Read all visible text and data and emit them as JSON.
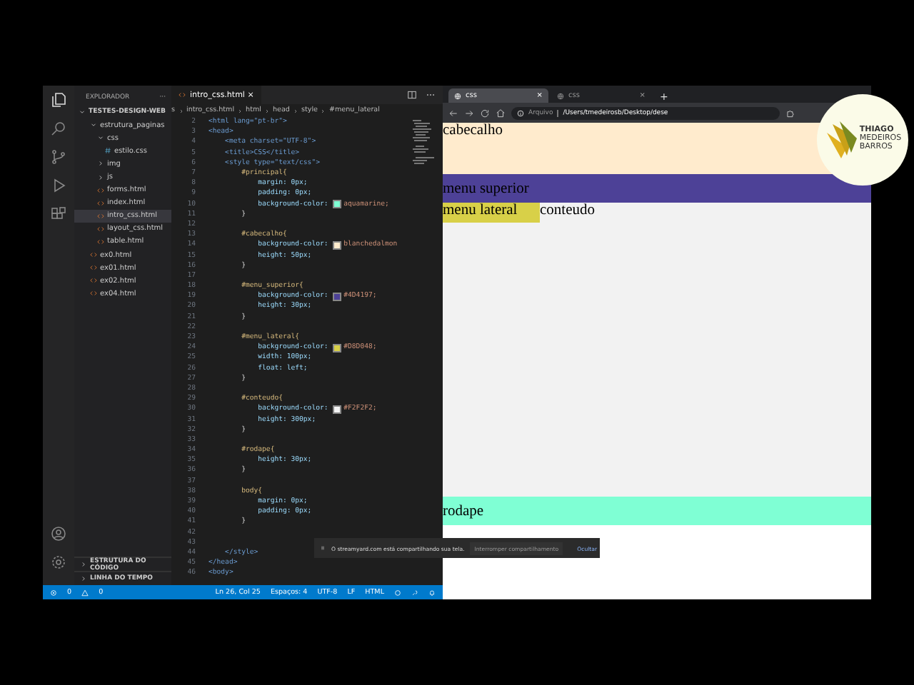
{
  "editor_window": {
    "explorer": {
      "title": "EXPLORADOR",
      "more": "···",
      "root": {
        "label": "TESTES-DESIGN-WEB",
        "expanded": true,
        "children": [
          {
            "label": "estrutura_paginas",
            "kind": "folder",
            "expanded": true,
            "selected": false,
            "children": [
              {
                "label": "css",
                "kind": "folder",
                "expanded": true,
                "selected": false,
                "children": [
                  {
                    "label": "estilo.css",
                    "kind": "css",
                    "selected": false
                  }
                ]
              },
              {
                "label": "img",
                "kind": "folder",
                "expanded": false,
                "selected": false
              },
              {
                "label": "js",
                "kind": "folder",
                "expanded": false,
                "selected": false
              },
              {
                "label": "forms.html",
                "kind": "html",
                "selected": false
              },
              {
                "label": "index.html",
                "kind": "html",
                "selected": false
              },
              {
                "label": "intro_css.html",
                "kind": "html",
                "selected": true
              },
              {
                "label": "layout_css.html",
                "kind": "html",
                "selected": false
              },
              {
                "label": "table.html",
                "kind": "html",
                "selected": false
              }
            ]
          },
          {
            "label": "ex0.html",
            "kind": "html",
            "selected": false
          },
          {
            "label": "ex01.html",
            "kind": "html",
            "selected": false
          },
          {
            "label": "ex02.html",
            "kind": "html",
            "selected": false
          },
          {
            "label": "ex04.html",
            "kind": "html",
            "selected": false
          }
        ]
      },
      "sections": [
        {
          "label": "ESTRUTURA DO CÓDIGO",
          "expanded": false
        },
        {
          "label": "LINHA DO TEMPO",
          "expanded": false
        }
      ]
    },
    "tab": {
      "label": "intro_css.html",
      "close": "×"
    },
    "breadcrumbs": [
      "s",
      "intro_css.html",
      "html",
      "head",
      "style",
      "#menu_lateral"
    ],
    "code": {
      "lines": [
        {
          "n": "2",
          "kind": "tag",
          "text": "<html lang=\"pt-br\">"
        },
        {
          "n": "3",
          "kind": "tag",
          "text": "<head>"
        },
        {
          "n": "4",
          "kind": "tag",
          "text": "    <meta charset=\"UTF-8\">"
        },
        {
          "n": "5",
          "kind": "tag",
          "text": "    <title>CSS</title>"
        },
        {
          "n": "6",
          "kind": "tag",
          "text": "    <style type=\"text/css\">"
        },
        {
          "n": "7",
          "kind": "selector",
          "text": "        #principal{"
        },
        {
          "n": "8",
          "kind": "prop",
          "text": "            margin: 0px;"
        },
        {
          "n": "9",
          "kind": "prop",
          "text": "            padding: 0px;"
        },
        {
          "n": "10",
          "kind": "prop",
          "text": "            background-color: ",
          "color": "#7fffd4",
          "value": "aquamarine;"
        },
        {
          "n": "11",
          "kind": "brace",
          "text": "        }"
        },
        {
          "n": "12"
        },
        {
          "n": "13",
          "kind": "selector",
          "text": "        #cabecalho{"
        },
        {
          "n": "14",
          "kind": "prop",
          "text": "            background-color: ",
          "color": "#ffebcd",
          "value": "blanchedalmon"
        },
        {
          "n": "15",
          "kind": "prop",
          "text": "            height: 50px;"
        },
        {
          "n": "16",
          "kind": "brace",
          "text": "        }"
        },
        {
          "n": "17"
        },
        {
          "n": "18",
          "kind": "selector",
          "text": "        #menu_superior{"
        },
        {
          "n": "19",
          "kind": "prop",
          "text": "            background-color: ",
          "color": "#4d4197",
          "value": "#4D4197;"
        },
        {
          "n": "20",
          "kind": "prop",
          "text": "            height: 30px;"
        },
        {
          "n": "21",
          "kind": "brace",
          "text": "        }"
        },
        {
          "n": "22"
        },
        {
          "n": "23",
          "kind": "selector",
          "text": "        #menu_lateral{"
        },
        {
          "n": "24",
          "kind": "prop",
          "text": "            background-color: ",
          "color": "#d8d048",
          "value": "#D8D048;"
        },
        {
          "n": "25",
          "kind": "prop",
          "text": "            width: 100px;"
        },
        {
          "n": "26",
          "kind": "prop",
          "text": "            float: left;"
        },
        {
          "n": "27",
          "kind": "brace",
          "text": "        }"
        },
        {
          "n": "28"
        },
        {
          "n": "29",
          "kind": "selector",
          "text": "        #conteudo{"
        },
        {
          "n": "30",
          "kind": "prop",
          "text": "            background-color: ",
          "color": "#f2f2f2",
          "value": "#F2F2F2;"
        },
        {
          "n": "31",
          "kind": "prop",
          "text": "            height: 300px;"
        },
        {
          "n": "32",
          "kind": "brace",
          "text": "        }"
        },
        {
          "n": "33"
        },
        {
          "n": "34",
          "kind": "selector",
          "text": "        #rodape{"
        },
        {
          "n": "35",
          "kind": "prop",
          "text": "            height: 30px;"
        },
        {
          "n": "36",
          "kind": "brace",
          "text": "        }"
        },
        {
          "n": "37"
        },
        {
          "n": "38",
          "kind": "selector",
          "text": "        body{"
        },
        {
          "n": "39",
          "kind": "prop",
          "text": "            margin: 0px;"
        },
        {
          "n": "40",
          "kind": "prop",
          "text": "            padding: 0px;"
        },
        {
          "n": "41",
          "kind": "brace",
          "text": "        }"
        },
        {
          "n": "42"
        },
        {
          "n": "43"
        },
        {
          "n": "44",
          "kind": "tag",
          "text": "    </style>"
        },
        {
          "n": "45",
          "kind": "tag",
          "text": "</head>"
        },
        {
          "n": "46",
          "kind": "tag",
          "text": "<body>"
        }
      ]
    },
    "status_bar": {
      "errors": "0",
      "warnings": "0",
      "items": [
        "Ln 26, Col 25",
        "Espaços: 4",
        "UTF-8",
        "LF",
        "HTML"
      ]
    }
  },
  "browser": {
    "tabs": [
      {
        "label": "css",
        "selected": true
      },
      {
        "label": "css",
        "selected": false
      }
    ],
    "close": "×",
    "new_tab": "+",
    "address": {
      "scheme": "Arquivo",
      "path": "/Users/tmedeirosb/Desktop/dese"
    },
    "page": {
      "header": "cabecalho",
      "top_menu": "menu superior",
      "side_menu": "menu lateral",
      "content": "conteudo",
      "footer": "rodape"
    }
  },
  "share_notice": {
    "text": "O streamyard.com está compartilhando sua tela.",
    "stop": "Interromper compartilhamento",
    "hide": "Ocultar"
  },
  "logo_badge": {
    "lines": [
      "THIAGO",
      "MEDEIROS",
      "BARROS"
    ]
  }
}
